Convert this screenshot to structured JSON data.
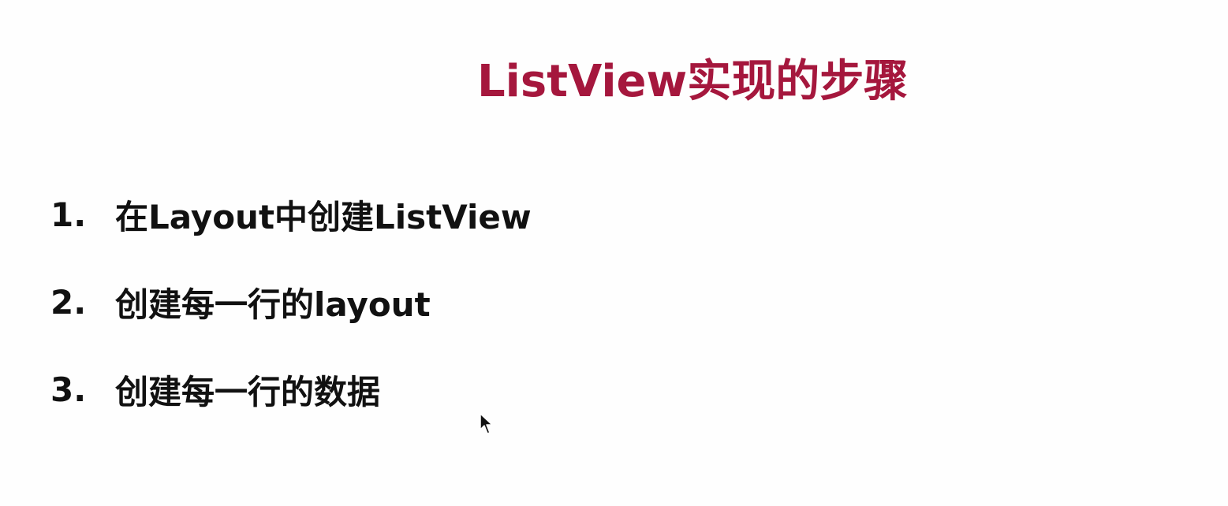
{
  "slide": {
    "title": "ListView实现的步骤",
    "steps": [
      {
        "number": "1.",
        "text": "在Layout中创建ListView"
      },
      {
        "number": "2.",
        "text": "创建每一行的layout"
      },
      {
        "number": "3.",
        "text": "创建每一行的数据"
      }
    ]
  },
  "colors": {
    "title": "#a5173d",
    "text": "#111111",
    "background": "#fefefe"
  },
  "icons": {
    "cursor": "mouse-pointer-icon"
  }
}
